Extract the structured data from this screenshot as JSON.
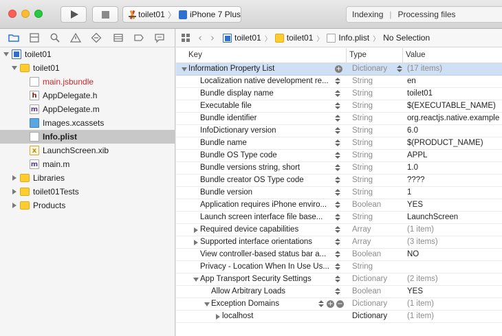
{
  "toolbar": {
    "scheme_target": "toilet01",
    "device": "iPhone 7 Plus",
    "activity_status": "Indexing",
    "activity_detail": "Processing files"
  },
  "navigator": {
    "tabs": [
      "folder-icon",
      "hierarchy-icon",
      "search-icon",
      "warning-icon",
      "test-icon",
      "debug-icon",
      "breakpoint-icon",
      "report-icon"
    ],
    "tree": [
      {
        "label": "toilet01",
        "icon": "project-icon",
        "depth": 0,
        "disclosure": "open"
      },
      {
        "label": "toilet01",
        "icon": "folder-icon",
        "depth": 1,
        "disclosure": "open"
      },
      {
        "label": "main.jsbundle",
        "icon": "file-icon",
        "depth": 2,
        "disclosure": "none",
        "color": "red"
      },
      {
        "label": "AppDelegate.h",
        "icon": "header-file-icon",
        "depth": 2,
        "disclosure": "none"
      },
      {
        "label": "AppDelegate.m",
        "icon": "implementation-file-icon",
        "depth": 2,
        "disclosure": "none"
      },
      {
        "label": "Images.xcassets",
        "icon": "assets-icon",
        "depth": 2,
        "disclosure": "none"
      },
      {
        "label": "Info.plist",
        "icon": "plist-file-icon",
        "depth": 2,
        "disclosure": "none",
        "selected": true
      },
      {
        "label": "LaunchScreen.xib",
        "icon": "xib-file-icon",
        "depth": 2,
        "disclosure": "none"
      },
      {
        "label": "main.m",
        "icon": "implementation-file-icon",
        "depth": 2,
        "disclosure": "none"
      },
      {
        "label": "Libraries",
        "icon": "folder-icon",
        "depth": 1,
        "disclosure": "closed"
      },
      {
        "label": "toilet01Tests",
        "icon": "folder-icon",
        "depth": 1,
        "disclosure": "closed"
      },
      {
        "label": "Products",
        "icon": "folder-icon",
        "depth": 1,
        "disclosure": "closed"
      }
    ]
  },
  "jumpbar": {
    "crumbs": [
      "toilet01",
      "toilet01",
      "Info.plist",
      "No Selection"
    ]
  },
  "plist": {
    "headers": {
      "key": "Key",
      "type": "Type",
      "value": "Value"
    },
    "rows": [
      {
        "key": "Information Property List",
        "type": "Dictionary",
        "value": "(17 items)",
        "depth": 0,
        "disclosure": "open",
        "selected": true,
        "value_grey": true,
        "add": true
      },
      {
        "key": "Localization native development re...",
        "type": "String",
        "value": "en",
        "depth": 1
      },
      {
        "key": "Bundle display name",
        "type": "String",
        "value": "toilet01",
        "depth": 1
      },
      {
        "key": "Executable file",
        "type": "String",
        "value": "$(EXECUTABLE_NAME)",
        "depth": 1
      },
      {
        "key": "Bundle identifier",
        "type": "String",
        "value": "org.reactjs.native.example",
        "depth": 1
      },
      {
        "key": "InfoDictionary version",
        "type": "String",
        "value": "6.0",
        "depth": 1
      },
      {
        "key": "Bundle name",
        "type": "String",
        "value": "$(PRODUCT_NAME)",
        "depth": 1
      },
      {
        "key": "Bundle OS Type code",
        "type": "String",
        "value": "APPL",
        "depth": 1
      },
      {
        "key": "Bundle versions string, short",
        "type": "String",
        "value": "1.0",
        "depth": 1
      },
      {
        "key": "Bundle creator OS Type code",
        "type": "String",
        "value": "????",
        "depth": 1
      },
      {
        "key": "Bundle version",
        "type": "String",
        "value": "1",
        "depth": 1
      },
      {
        "key": "Application requires iPhone enviro...",
        "type": "Boolean",
        "value": "YES",
        "depth": 1
      },
      {
        "key": "Launch screen interface file base...",
        "type": "String",
        "value": "LaunchScreen",
        "depth": 1
      },
      {
        "key": "Required device capabilities",
        "type": "Array",
        "value": "(1 item)",
        "depth": 1,
        "disclosure": "closed",
        "value_grey": true
      },
      {
        "key": "Supported interface orientations",
        "type": "Array",
        "value": "(3 items)",
        "depth": 1,
        "disclosure": "closed",
        "value_grey": true
      },
      {
        "key": "View controller-based status bar a...",
        "type": "Boolean",
        "value": "NO",
        "depth": 1
      },
      {
        "key": "Privacy - Location When In Use Us...",
        "type": "String",
        "value": "",
        "depth": 1
      },
      {
        "key": "App Transport Security Settings",
        "type": "Dictionary",
        "value": "(2 items)",
        "depth": 1,
        "disclosure": "open",
        "value_grey": true
      },
      {
        "key": "Allow Arbitrary Loads",
        "type": "Boolean",
        "value": "YES",
        "depth": 2
      },
      {
        "key": "Exception Domains",
        "type": "Dictionary",
        "value": "(1 item)",
        "depth": 2,
        "disclosure": "open",
        "value_grey": true,
        "add": true,
        "remove": true
      },
      {
        "key": "localhost",
        "type": "Dictionary",
        "value": "(1 item)",
        "depth": 3,
        "disclosure": "closed",
        "value_grey": true,
        "type_dark": true,
        "no_stepper": true
      }
    ]
  }
}
